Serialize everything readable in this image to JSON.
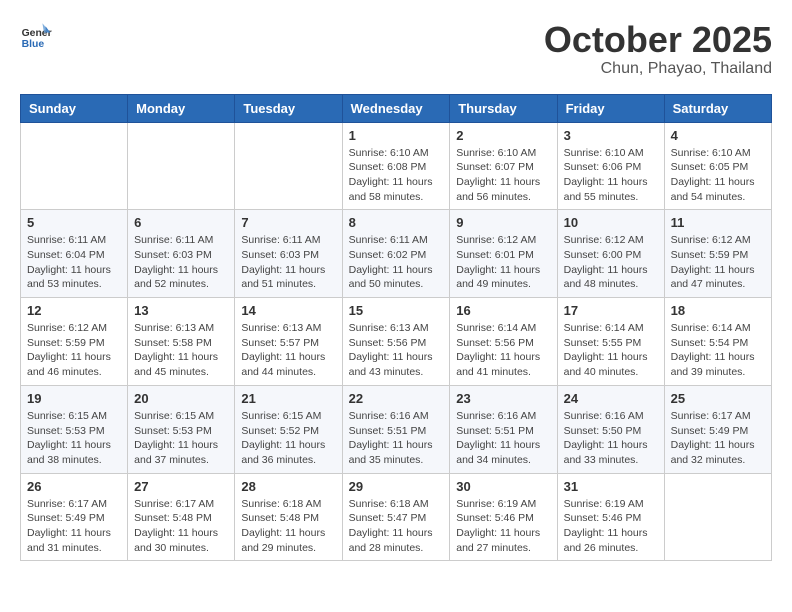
{
  "header": {
    "logo_general": "General",
    "logo_blue": "Blue",
    "month": "October 2025",
    "location": "Chun, Phayao, Thailand"
  },
  "weekdays": [
    "Sunday",
    "Monday",
    "Tuesday",
    "Wednesday",
    "Thursday",
    "Friday",
    "Saturday"
  ],
  "weeks": [
    [
      null,
      null,
      null,
      {
        "day": 1,
        "sunrise": "Sunrise: 6:10 AM",
        "sunset": "Sunset: 6:08 PM",
        "daylight": "Daylight: 11 hours and 58 minutes."
      },
      {
        "day": 2,
        "sunrise": "Sunrise: 6:10 AM",
        "sunset": "Sunset: 6:07 PM",
        "daylight": "Daylight: 11 hours and 56 minutes."
      },
      {
        "day": 3,
        "sunrise": "Sunrise: 6:10 AM",
        "sunset": "Sunset: 6:06 PM",
        "daylight": "Daylight: 11 hours and 55 minutes."
      },
      {
        "day": 4,
        "sunrise": "Sunrise: 6:10 AM",
        "sunset": "Sunset: 6:05 PM",
        "daylight": "Daylight: 11 hours and 54 minutes."
      }
    ],
    [
      {
        "day": 5,
        "sunrise": "Sunrise: 6:11 AM",
        "sunset": "Sunset: 6:04 PM",
        "daylight": "Daylight: 11 hours and 53 minutes."
      },
      {
        "day": 6,
        "sunrise": "Sunrise: 6:11 AM",
        "sunset": "Sunset: 6:03 PM",
        "daylight": "Daylight: 11 hours and 52 minutes."
      },
      {
        "day": 7,
        "sunrise": "Sunrise: 6:11 AM",
        "sunset": "Sunset: 6:03 PM",
        "daylight": "Daylight: 11 hours and 51 minutes."
      },
      {
        "day": 8,
        "sunrise": "Sunrise: 6:11 AM",
        "sunset": "Sunset: 6:02 PM",
        "daylight": "Daylight: 11 hours and 50 minutes."
      },
      {
        "day": 9,
        "sunrise": "Sunrise: 6:12 AM",
        "sunset": "Sunset: 6:01 PM",
        "daylight": "Daylight: 11 hours and 49 minutes."
      },
      {
        "day": 10,
        "sunrise": "Sunrise: 6:12 AM",
        "sunset": "Sunset: 6:00 PM",
        "daylight": "Daylight: 11 hours and 48 minutes."
      },
      {
        "day": 11,
        "sunrise": "Sunrise: 6:12 AM",
        "sunset": "Sunset: 5:59 PM",
        "daylight": "Daylight: 11 hours and 47 minutes."
      }
    ],
    [
      {
        "day": 12,
        "sunrise": "Sunrise: 6:12 AM",
        "sunset": "Sunset: 5:59 PM",
        "daylight": "Daylight: 11 hours and 46 minutes."
      },
      {
        "day": 13,
        "sunrise": "Sunrise: 6:13 AM",
        "sunset": "Sunset: 5:58 PM",
        "daylight": "Daylight: 11 hours and 45 minutes."
      },
      {
        "day": 14,
        "sunrise": "Sunrise: 6:13 AM",
        "sunset": "Sunset: 5:57 PM",
        "daylight": "Daylight: 11 hours and 44 minutes."
      },
      {
        "day": 15,
        "sunrise": "Sunrise: 6:13 AM",
        "sunset": "Sunset: 5:56 PM",
        "daylight": "Daylight: 11 hours and 43 minutes."
      },
      {
        "day": 16,
        "sunrise": "Sunrise: 6:14 AM",
        "sunset": "Sunset: 5:56 PM",
        "daylight": "Daylight: 11 hours and 41 minutes."
      },
      {
        "day": 17,
        "sunrise": "Sunrise: 6:14 AM",
        "sunset": "Sunset: 5:55 PM",
        "daylight": "Daylight: 11 hours and 40 minutes."
      },
      {
        "day": 18,
        "sunrise": "Sunrise: 6:14 AM",
        "sunset": "Sunset: 5:54 PM",
        "daylight": "Daylight: 11 hours and 39 minutes."
      }
    ],
    [
      {
        "day": 19,
        "sunrise": "Sunrise: 6:15 AM",
        "sunset": "Sunset: 5:53 PM",
        "daylight": "Daylight: 11 hours and 38 minutes."
      },
      {
        "day": 20,
        "sunrise": "Sunrise: 6:15 AM",
        "sunset": "Sunset: 5:53 PM",
        "daylight": "Daylight: 11 hours and 37 minutes."
      },
      {
        "day": 21,
        "sunrise": "Sunrise: 6:15 AM",
        "sunset": "Sunset: 5:52 PM",
        "daylight": "Daylight: 11 hours and 36 minutes."
      },
      {
        "day": 22,
        "sunrise": "Sunrise: 6:16 AM",
        "sunset": "Sunset: 5:51 PM",
        "daylight": "Daylight: 11 hours and 35 minutes."
      },
      {
        "day": 23,
        "sunrise": "Sunrise: 6:16 AM",
        "sunset": "Sunset: 5:51 PM",
        "daylight": "Daylight: 11 hours and 34 minutes."
      },
      {
        "day": 24,
        "sunrise": "Sunrise: 6:16 AM",
        "sunset": "Sunset: 5:50 PM",
        "daylight": "Daylight: 11 hours and 33 minutes."
      },
      {
        "day": 25,
        "sunrise": "Sunrise: 6:17 AM",
        "sunset": "Sunset: 5:49 PM",
        "daylight": "Daylight: 11 hours and 32 minutes."
      }
    ],
    [
      {
        "day": 26,
        "sunrise": "Sunrise: 6:17 AM",
        "sunset": "Sunset: 5:49 PM",
        "daylight": "Daylight: 11 hours and 31 minutes."
      },
      {
        "day": 27,
        "sunrise": "Sunrise: 6:17 AM",
        "sunset": "Sunset: 5:48 PM",
        "daylight": "Daylight: 11 hours and 30 minutes."
      },
      {
        "day": 28,
        "sunrise": "Sunrise: 6:18 AM",
        "sunset": "Sunset: 5:48 PM",
        "daylight": "Daylight: 11 hours and 29 minutes."
      },
      {
        "day": 29,
        "sunrise": "Sunrise: 6:18 AM",
        "sunset": "Sunset: 5:47 PM",
        "daylight": "Daylight: 11 hours and 28 minutes."
      },
      {
        "day": 30,
        "sunrise": "Sunrise: 6:19 AM",
        "sunset": "Sunset: 5:46 PM",
        "daylight": "Daylight: 11 hours and 27 minutes."
      },
      {
        "day": 31,
        "sunrise": "Sunrise: 6:19 AM",
        "sunset": "Sunset: 5:46 PM",
        "daylight": "Daylight: 11 hours and 26 minutes."
      },
      null
    ]
  ]
}
